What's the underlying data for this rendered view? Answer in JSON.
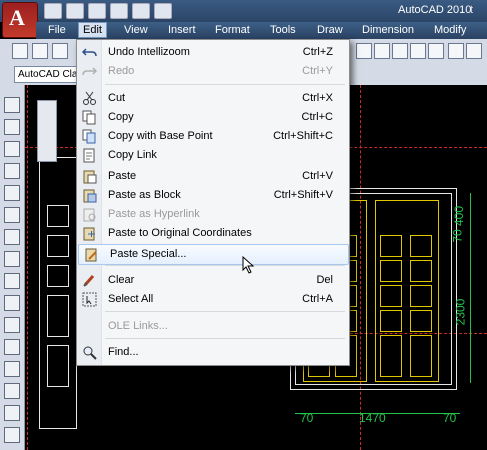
{
  "app": {
    "title": "AutoCAD 2010",
    "title_extra": "t"
  },
  "menubar": {
    "items": [
      {
        "label": "File"
      },
      {
        "label": "Edit"
      },
      {
        "label": "View"
      },
      {
        "label": "Insert"
      },
      {
        "label": "Format"
      },
      {
        "label": "Tools"
      },
      {
        "label": "Draw"
      },
      {
        "label": "Dimension"
      },
      {
        "label": "Modify"
      }
    ],
    "active_index": 1
  },
  "workspace": {
    "value": "AutoCAD Cla"
  },
  "edit_menu": {
    "items": [
      {
        "label": "Undo Intellizoom",
        "shortcut": "Ctrl+Z",
        "icon": "undo-icon",
        "disabled": false
      },
      {
        "label": "Redo",
        "shortcut": "Ctrl+Y",
        "icon": "redo-icon",
        "disabled": true
      },
      {
        "label": "Cut",
        "shortcut": "Ctrl+X",
        "icon": "scissors-icon",
        "disabled": false
      },
      {
        "label": "Copy",
        "shortcut": "Ctrl+C",
        "icon": "copy-icon",
        "disabled": false
      },
      {
        "label": "Copy with Base Point",
        "shortcut": "Ctrl+Shift+C",
        "icon": "copy-base-point-icon",
        "disabled": false
      },
      {
        "label": "Copy Link",
        "shortcut": "",
        "icon": "copy-link-icon",
        "disabled": false
      },
      {
        "label": "Paste",
        "shortcut": "Ctrl+V",
        "icon": "paste-icon",
        "disabled": false
      },
      {
        "label": "Paste as Block",
        "shortcut": "Ctrl+Shift+V",
        "icon": "paste-block-icon",
        "disabled": false
      },
      {
        "label": "Paste as Hyperlink",
        "shortcut": "",
        "icon": "paste-hyperlink-icon",
        "disabled": true
      },
      {
        "label": "Paste to Original Coordinates",
        "shortcut": "",
        "icon": "paste-original-icon",
        "disabled": false
      },
      {
        "label": "Paste Special...",
        "shortcut": "",
        "icon": "paste-special-icon",
        "disabled": false,
        "highlighted": true
      },
      {
        "label": "Clear",
        "shortcut": "Del",
        "icon": "eraser-icon",
        "disabled": false
      },
      {
        "label": "Select All",
        "shortcut": "Ctrl+A",
        "icon": "select-all-icon",
        "disabled": false
      },
      {
        "label": "OLE Links...",
        "shortcut": "",
        "icon": "",
        "disabled": true
      },
      {
        "label": "Find...",
        "shortcut": "",
        "icon": "find-icon",
        "disabled": false
      }
    ]
  },
  "drawing": {
    "dimensions": [
      {
        "text": "70"
      },
      {
        "text": "1470"
      },
      {
        "text": "70"
      },
      {
        "text": "400"
      },
      {
        "text": "70"
      },
      {
        "text": "2300"
      }
    ]
  },
  "colors": {
    "accent": "#2b4566",
    "dim": "#22c24a",
    "highlight": "#e5f0fd",
    "center_line": "#cc2b2b"
  }
}
